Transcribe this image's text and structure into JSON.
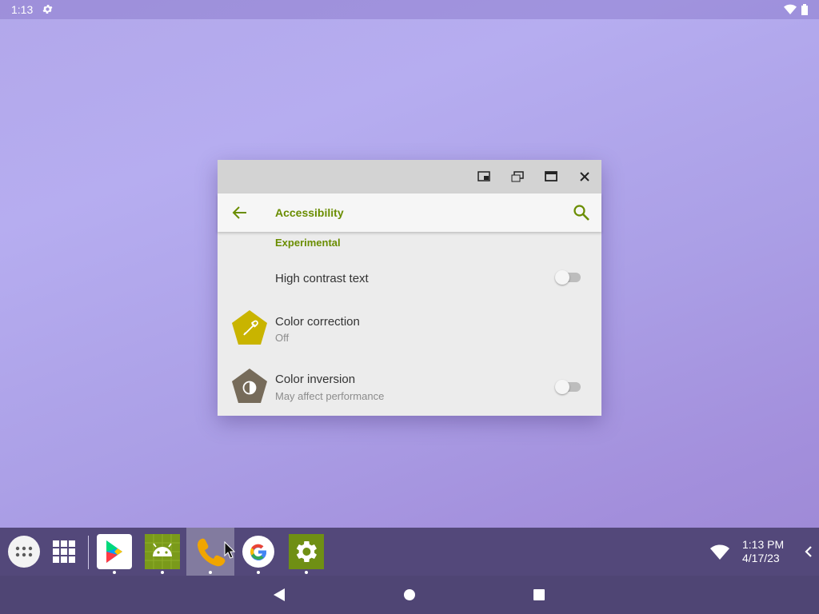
{
  "status_bar": {
    "time": "1:13",
    "icons": [
      "settings-gear-icon",
      "wifi-icon",
      "battery-icon"
    ]
  },
  "window": {
    "controls": [
      "pip-icon",
      "restore-icon",
      "maximize-icon",
      "close-icon"
    ],
    "app_bar": {
      "title": "Accessibility",
      "icons": [
        "back-arrow-icon",
        "search-icon"
      ]
    },
    "section_header": "Experimental",
    "items": [
      {
        "title": "High contrast text",
        "toggle": "off"
      },
      {
        "title": "Color correction",
        "subtitle": "Off",
        "icon": "eyedropper-icon"
      },
      {
        "title": "Color inversion",
        "subtitle": "May affect performance",
        "icon": "invert-colors-icon",
        "toggle": "off"
      }
    ],
    "accent_color": "#6a8d00"
  },
  "taskbar": {
    "apps": [
      "app-drawer",
      "recent-apps-grid",
      "play-store",
      "android-app",
      "phone",
      "google",
      "settings"
    ],
    "active_app": "phone",
    "clock_time": "1:13 PM",
    "clock_date": "4/17/23"
  },
  "nav_bar": [
    "back",
    "home",
    "overview"
  ]
}
